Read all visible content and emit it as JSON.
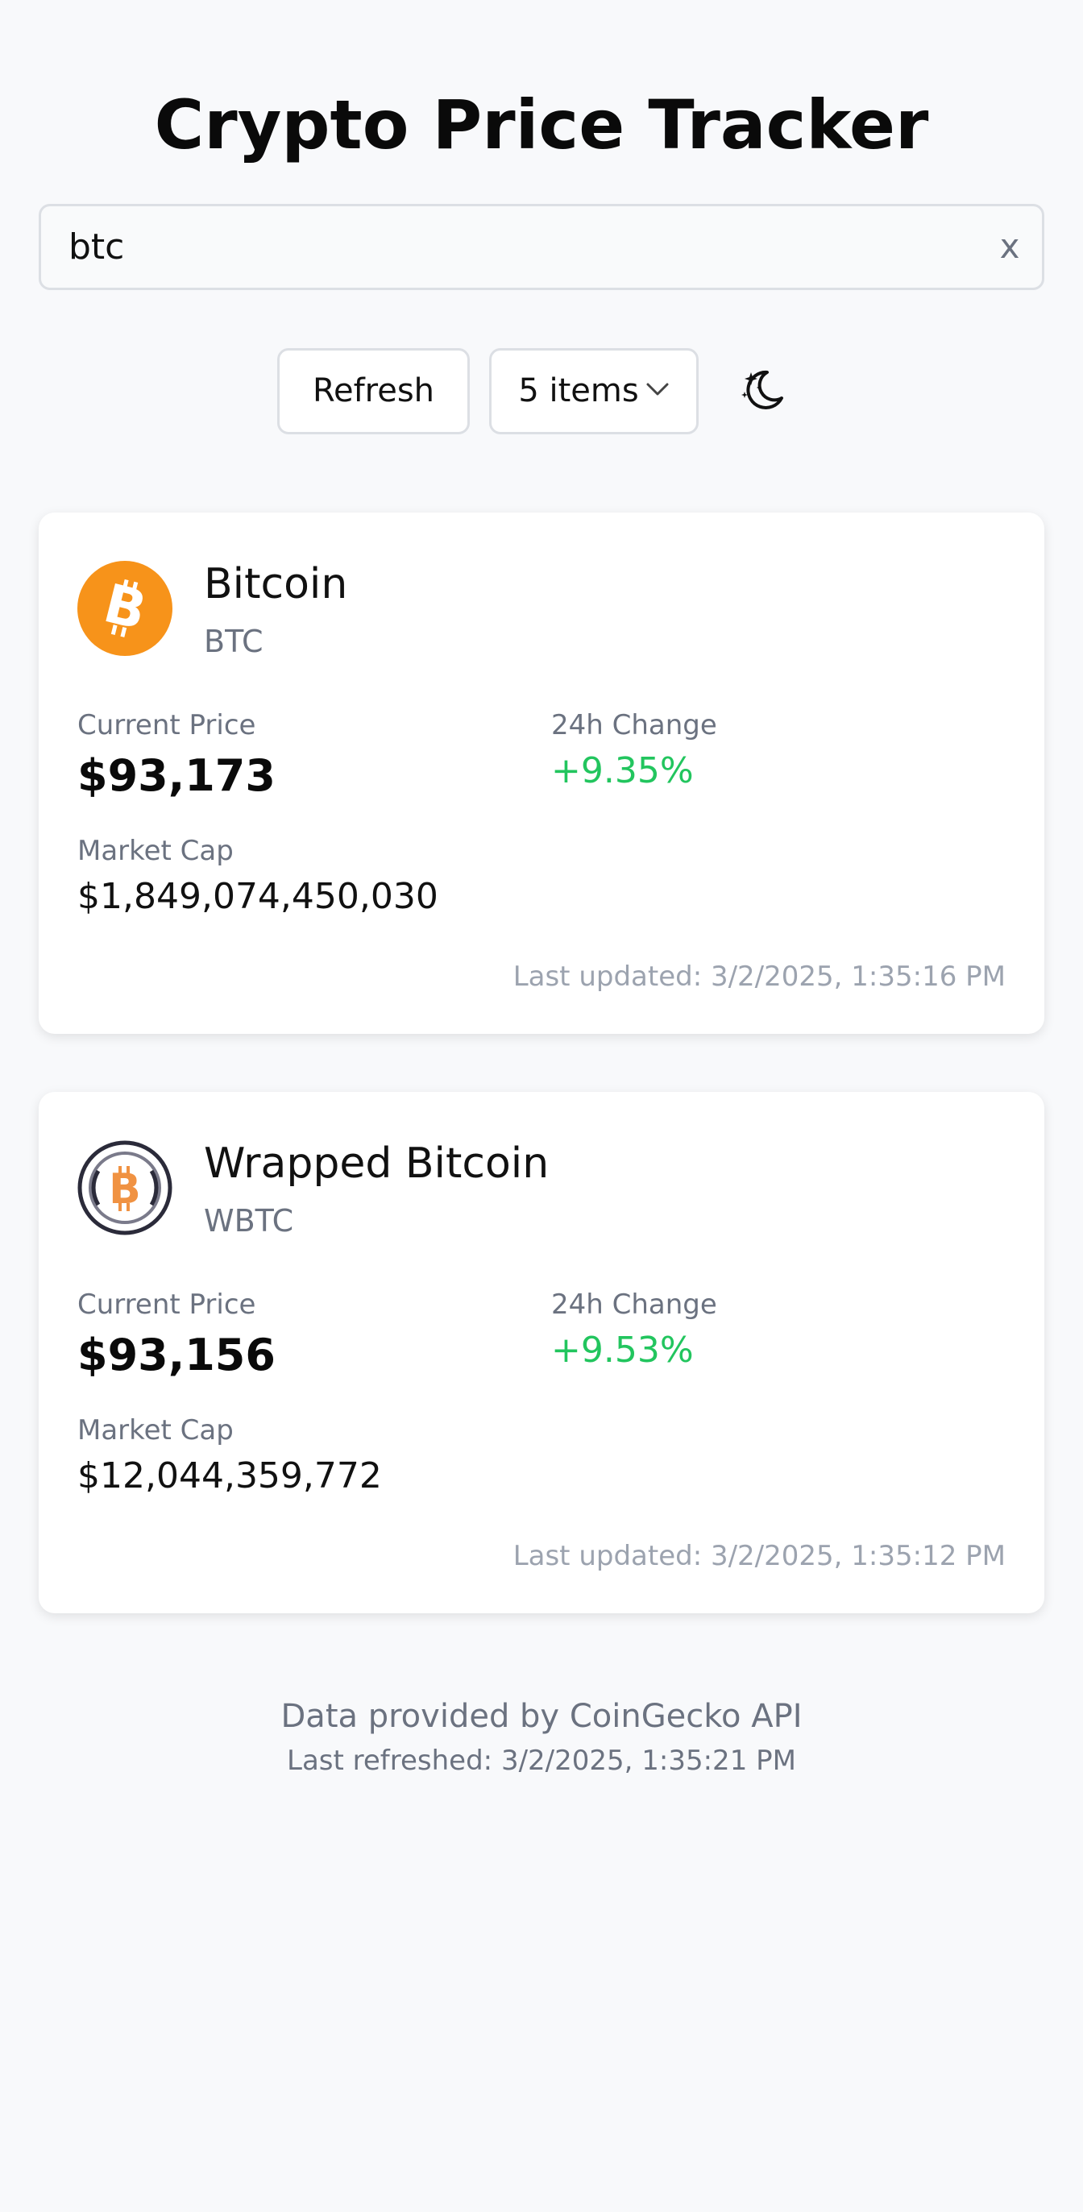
{
  "header": {
    "title": "Crypto Price Tracker"
  },
  "search": {
    "value": "btc",
    "clear_label": "x"
  },
  "controls": {
    "refresh_label": "Refresh",
    "items_label": "5 items",
    "theme_icon": "moon-stars-icon"
  },
  "coins": [
    {
      "name": "Bitcoin",
      "symbol": "BTC",
      "icon": "bitcoin-logo",
      "price_label": "Current Price",
      "price": "$93,173",
      "change_label": "24h Change",
      "change": "+9.35%",
      "market_cap_label": "Market Cap",
      "market_cap": "$1,849,074,450,030",
      "last_updated": "Last updated: 3/2/2025, 1:35:16 PM"
    },
    {
      "name": "Wrapped Bitcoin",
      "symbol": "WBTC",
      "icon": "wrapped-bitcoin-logo",
      "price_label": "Current Price",
      "price": "$93,156",
      "change_label": "24h Change",
      "change": "+9.53%",
      "market_cap_label": "Market Cap",
      "market_cap": "$12,044,359,772",
      "last_updated": "Last updated: 3/2/2025, 1:35:12 PM"
    }
  ],
  "footer": {
    "source": "Data provided by CoinGecko API",
    "last_refreshed": "Last refreshed: 3/2/2025, 1:35:21 PM"
  },
  "colors": {
    "background": "#f8f9fb",
    "positive_change": "#22c55e",
    "bitcoin_orange": "#f7931a",
    "muted_text": "#6b7280"
  }
}
